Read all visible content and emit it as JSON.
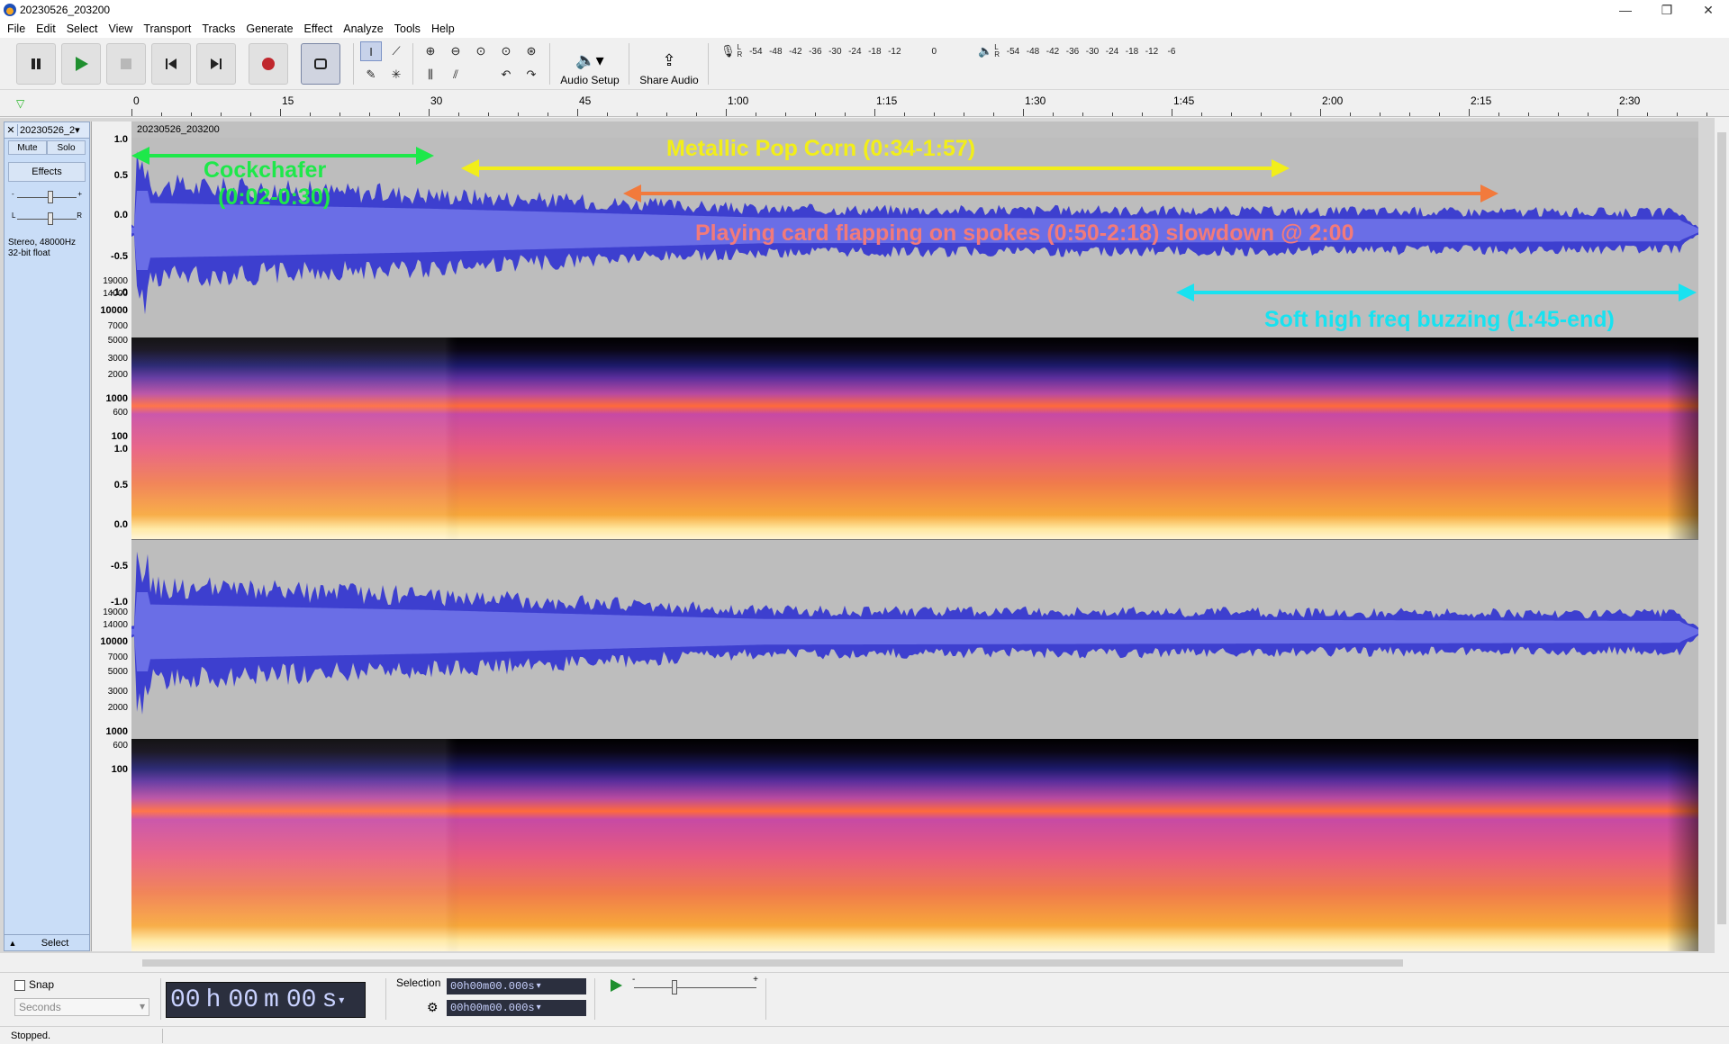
{
  "window": {
    "title": "20230526_203200",
    "controls": [
      "—",
      "❐",
      "✕"
    ]
  },
  "menu": [
    "File",
    "Edit",
    "Select",
    "View",
    "Transport",
    "Tracks",
    "Generate",
    "Effect",
    "Analyze",
    "Tools",
    "Help"
  ],
  "toolbar": {
    "audio_setup_label": "Audio Setup",
    "share_audio_label": "Share Audio",
    "record_meter_scale": [
      "-54",
      "-48",
      "-42",
      "-36",
      "-30",
      "-24",
      "-18",
      "-12",
      "",
      "0"
    ],
    "play_meter_scale": [
      "-54",
      "-48",
      "-42",
      "-36",
      "-30",
      "-24",
      "-18",
      "-12",
      "-6",
      ""
    ],
    "meter_l": "L",
    "meter_r": "R"
  },
  "ruler": {
    "ticks": [
      "0",
      "15",
      "30",
      "45",
      "1:00",
      "1:15",
      "1:30",
      "1:45",
      "2:00",
      "2:15",
      "2:30"
    ]
  },
  "track": {
    "close": "✕",
    "name": "20230526_2▾",
    "mute": "Mute",
    "solo": "Solo",
    "effects": "Effects",
    "gain_minus": "-",
    "gain_plus": "+",
    "pan_l": "L",
    "pan_r": "R",
    "info_line1": "Stereo, 48000Hz",
    "info_line2": "32-bit float",
    "select_label": "Select",
    "clip_name": "20230526_203200"
  },
  "vertical_ruler": {
    "wave_labels": [
      "1.0",
      "0.5",
      "0.0",
      "-0.5",
      "-1.0"
    ],
    "spectro_labels": [
      "19000",
      "14000",
      "10000",
      "7000",
      "5000",
      "3000",
      "2000",
      "1000",
      "600",
      "100"
    ]
  },
  "annotations": {
    "cockchafer_line1": "Cockchafer",
    "cockchafer_line2": "(0:02-0:30)",
    "popcorn": "Metallic Pop Corn (0:34-1:57)",
    "playing_card": "Playing card flapping on spokes (0:50-2:18) slowdown @ 2:00",
    "buzzing": "Soft high freq buzzing (1:45-end)",
    "colors": {
      "green": "#1ee84a",
      "yellow": "#f2ee1a",
      "orange": "#f27a3c",
      "cyan": "#18e2f0"
    }
  },
  "bottom": {
    "snap_label": "Snap",
    "snap_unit": "Seconds",
    "time_h": "00",
    "time_h_unit": "h",
    "time_m": "00",
    "time_m_unit": "m",
    "time_s": "00",
    "time_s_unit": "s",
    "selection_label": "Selection",
    "selection_start": "00h00m00.000s",
    "selection_end": "00h00m00.000s"
  },
  "status": {
    "text": "Stopped."
  }
}
